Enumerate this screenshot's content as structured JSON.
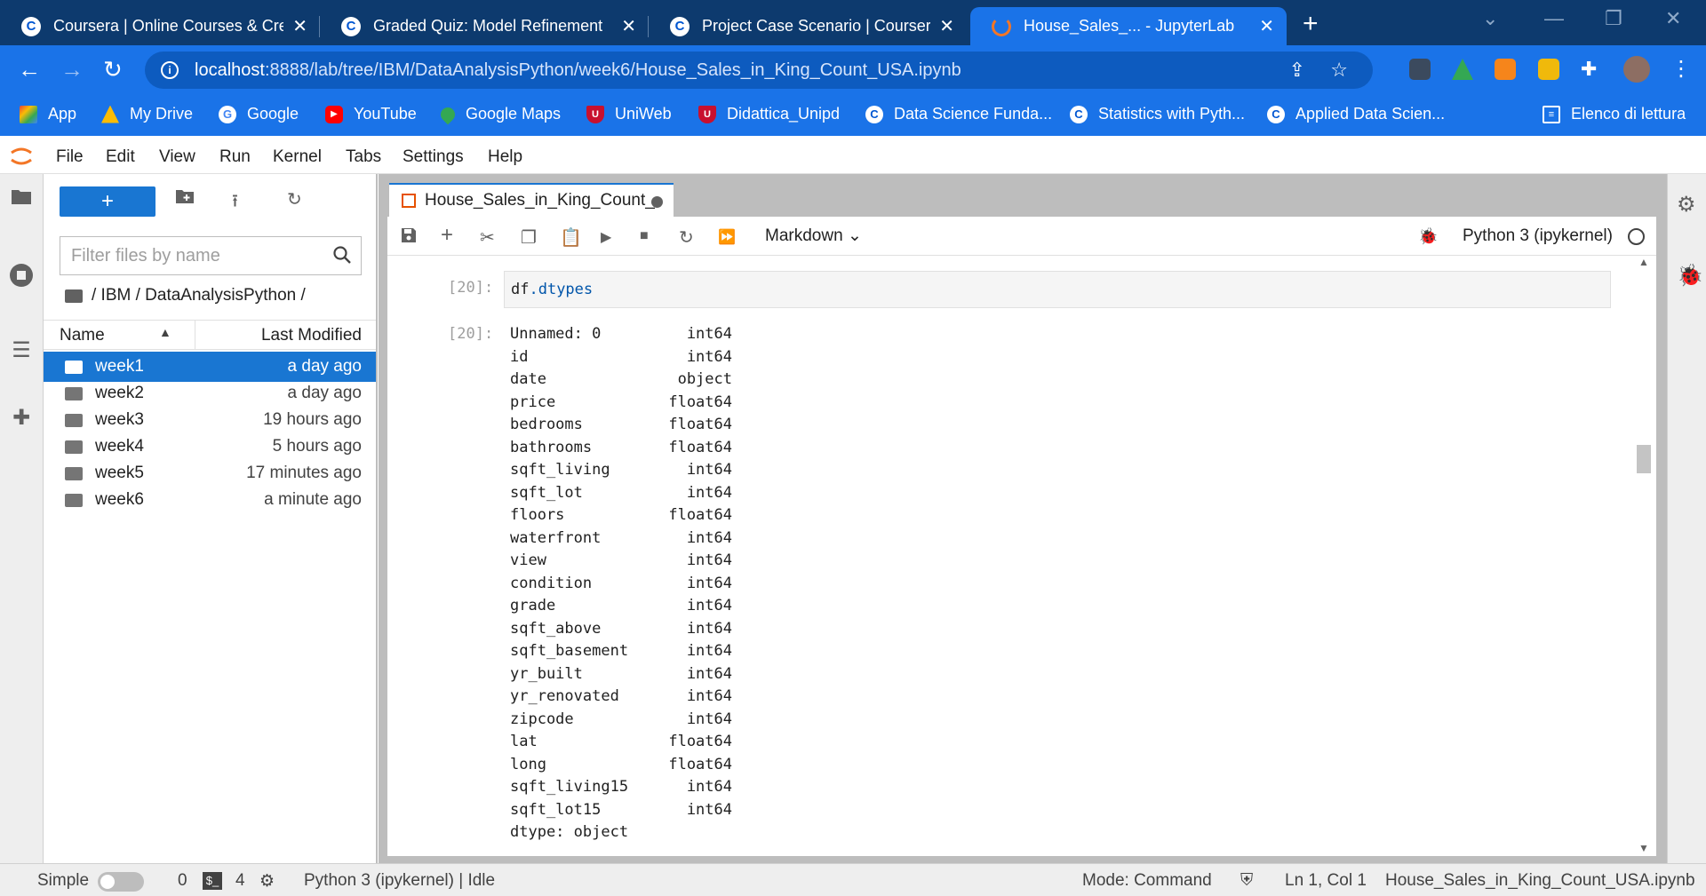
{
  "browser": {
    "tabs": [
      {
        "title": "Coursera | Online Courses & Crea",
        "favicon": "C"
      },
      {
        "title": "Graded Quiz: Model Refinement",
        "favicon": "C"
      },
      {
        "title": "Project Case Scenario | Coursera",
        "favicon": "C"
      },
      {
        "title": "House_Sales_... - JupyterLab",
        "favicon": ""
      }
    ],
    "new_tab": "+",
    "url_host": "localhost",
    "url_path": ":8888/lab/tree/IBM/DataAnalysisPython/week6/House_Sales_in_King_Count_USA.ipynb",
    "bookmarks": [
      {
        "label": "App",
        "icon": "apps-grid-icon"
      },
      {
        "label": "My Drive",
        "icon": "drive-icon"
      },
      {
        "label": "Google",
        "icon": "google-icon"
      },
      {
        "label": "YouTube",
        "icon": "youtube-icon"
      },
      {
        "label": "Google Maps",
        "icon": "maps-icon"
      },
      {
        "label": "UniWeb",
        "icon": "unipd-icon"
      },
      {
        "label": "Didattica_Unipd",
        "icon": "unipd-icon"
      },
      {
        "label": "Data Science Funda...",
        "icon": "coursera-icon"
      },
      {
        "label": "Statistics with Pyth...",
        "icon": "coursera-icon"
      },
      {
        "label": "Applied Data Scien...",
        "icon": "coursera-icon"
      }
    ],
    "reading_list": "Elenco di lettura"
  },
  "menubar": [
    "File",
    "Edit",
    "View",
    "Run",
    "Kernel",
    "Tabs",
    "Settings",
    "Help"
  ],
  "filebrowser": {
    "new_button": "+",
    "filter_placeholder": "Filter files by name",
    "breadcrumb": "/ IBM / DataAnalysisPython /",
    "col_name": "Name",
    "col_modified": "Last Modified",
    "files": [
      {
        "name": "week1",
        "modified": "a day ago"
      },
      {
        "name": "week2",
        "modified": "a day ago"
      },
      {
        "name": "week3",
        "modified": "19 hours ago"
      },
      {
        "name": "week4",
        "modified": "5 hours ago"
      },
      {
        "name": "week5",
        "modified": "17 minutes ago"
      },
      {
        "name": "week6",
        "modified": "a minute ago"
      }
    ]
  },
  "notebook": {
    "tab_title": "House_Sales_in_King_Count_",
    "cell_type": "Markdown",
    "kernel": "Python 3 (ipykernel)",
    "in_prompt": "[20]:",
    "out_prompt": "[20]:",
    "code_obj": "df",
    "code_attr": ".dtypes",
    "output": [
      {
        "k": "Unnamed: 0",
        "v": "int64"
      },
      {
        "k": "id",
        "v": "int64"
      },
      {
        "k": "date",
        "v": "object"
      },
      {
        "k": "price",
        "v": "float64"
      },
      {
        "k": "bedrooms",
        "v": "float64"
      },
      {
        "k": "bathrooms",
        "v": "float64"
      },
      {
        "k": "sqft_living",
        "v": "int64"
      },
      {
        "k": "sqft_lot",
        "v": "int64"
      },
      {
        "k": "floors",
        "v": "float64"
      },
      {
        "k": "waterfront",
        "v": "int64"
      },
      {
        "k": "view",
        "v": "int64"
      },
      {
        "k": "condition",
        "v": "int64"
      },
      {
        "k": "grade",
        "v": "int64"
      },
      {
        "k": "sqft_above",
        "v": "int64"
      },
      {
        "k": "sqft_basement",
        "v": "int64"
      },
      {
        "k": "yr_built",
        "v": "int64"
      },
      {
        "k": "yr_renovated",
        "v": "int64"
      },
      {
        "k": "zipcode",
        "v": "int64"
      },
      {
        "k": "lat",
        "v": "float64"
      },
      {
        "k": "long",
        "v": "float64"
      },
      {
        "k": "sqft_living15",
        "v": "int64"
      },
      {
        "k": "sqft_lot15",
        "v": "int64"
      },
      {
        "k": "dtype: object",
        "v": ""
      }
    ]
  },
  "statusbar": {
    "simple": "Simple",
    "count0": "0",
    "count4": "4",
    "kernel_status": "Python 3 (ipykernel) | Idle",
    "mode": "Mode: Command",
    "cursor": "Ln 1, Col 1",
    "filename": "House_Sales_in_King_Count_USA.ipynb"
  },
  "colors": {
    "accent": "#1976d2",
    "chrome": "#1a73e8",
    "tabstrip": "#0d3a6e",
    "jupyter_orange": "#f37626"
  }
}
